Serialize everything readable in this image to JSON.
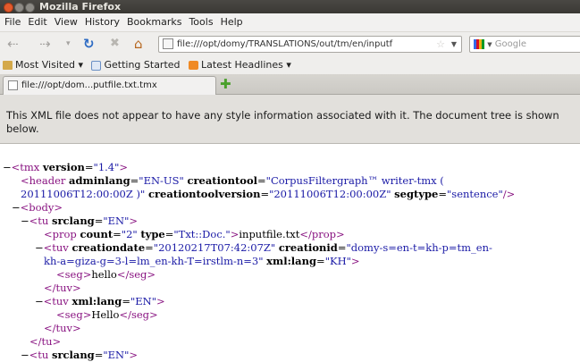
{
  "window": {
    "title": "Mozilla Firefox"
  },
  "menu": [
    "File",
    "Edit",
    "View",
    "History",
    "Bookmarks",
    "Tools",
    "Help"
  ],
  "toolbar": {
    "url": "file:///opt/domy/TRANSLATIONS/out/tm/en/inputf",
    "search_placeholder": "Google"
  },
  "bookmarks": {
    "items": [
      "Most Visited ▾",
      "Getting Started",
      "Latest Headlines ▾"
    ]
  },
  "tab": {
    "title": "file:///opt/dom...putfile.txt.tmx"
  },
  "info": {
    "message": "This XML file does not appear to have any style information associated with it. The document tree is shown below."
  },
  "xml": {
    "tmx_collapse": "−",
    "tmx_open": "<tmx",
    "tmx_version_attr": "version",
    "tmx_version_val": "\"1.4\"",
    "gt": ">",
    "header_open": "<header",
    "adminlang_attr": "adminlang",
    "adminlang_val": "\"EN-US\"",
    "creationtool_attr": "creationtool",
    "creationtool_val": "\"CorpusFiltergraph™ writer-tmx (",
    "creationtool_val_cont": "20111006T12:00:00Z )\"",
    "creationtoolversion_attr": "creationtoolversion",
    "creationtoolversion_val": "\"20111006T12:00:00Z\"",
    "segtype_attr": "segtype",
    "segtype_val": "\"sentence\"",
    "selfclose": "/>",
    "body_open": "<body>",
    "tu_open": "<tu",
    "srclang_attr": "srclang",
    "srclang_val": "\"EN\"",
    "prop_open": "<prop",
    "count_attr": "count",
    "count_val": "\"2\"",
    "type_attr": "type",
    "type_val": "\"Txt::Doc.\"",
    "prop_text": "inputfile.txt",
    "prop_close": "</prop>",
    "tuv_open": "<tuv",
    "creationdate_attr": "creationdate",
    "creationdate_val": "\"20120217T07:42:07Z\"",
    "creationid_attr": "creationid",
    "creationid_val": "\"domy-s=en-t=kh-p=tm_en-",
    "creationid_val_cont": "kh-a=giza-g=3-l=lm_en-kh-T=irstlm-n=3\"",
    "xmllang_attr": "xml:lang",
    "xmllang_kh": "\"KH\"",
    "seg_open": "<seg>",
    "seg_text_1": "hello",
    "seg_close": "</seg>",
    "tuv_close": "</tuv>",
    "xmllang_en": "\"EN\"",
    "seg_text_2": "Hello",
    "tu_close": "</tu>"
  }
}
